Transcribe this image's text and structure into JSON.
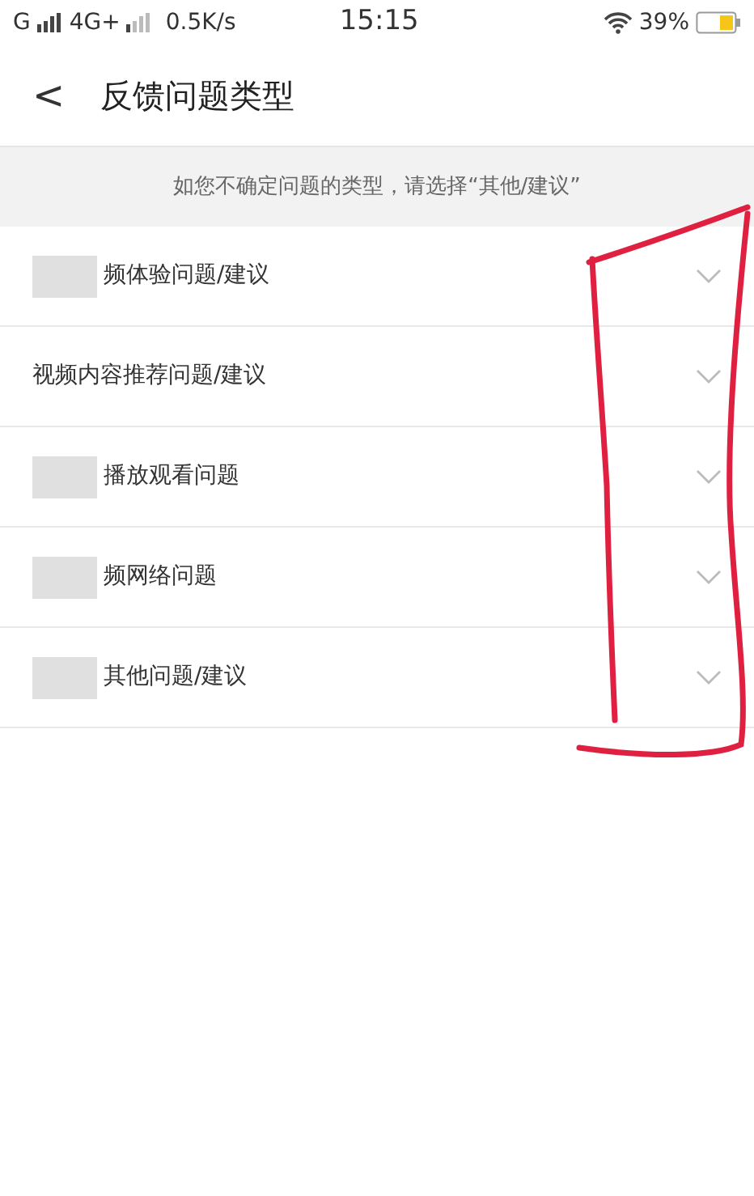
{
  "status_bar": {
    "carrier_1": "G",
    "carrier_2": "4G+",
    "speed": "0.5K/s",
    "time": "15:15",
    "battery": "39%"
  },
  "header": {
    "back": "<",
    "title": "反馈问题类型"
  },
  "hint": "如您不确定问题的类型，请选择“其他/建议”",
  "items": [
    {
      "label": "频体验问题/建议",
      "redacted": true
    },
    {
      "label": "视频内容推荐问题/建议",
      "redacted": false
    },
    {
      "label": "播放观看问题",
      "redacted": true
    },
    {
      "label": "频网络问题",
      "redacted": true
    },
    {
      "label": "其他问题/建议",
      "redacted": true
    }
  ],
  "annotation": {
    "kind": "red-scribble"
  }
}
